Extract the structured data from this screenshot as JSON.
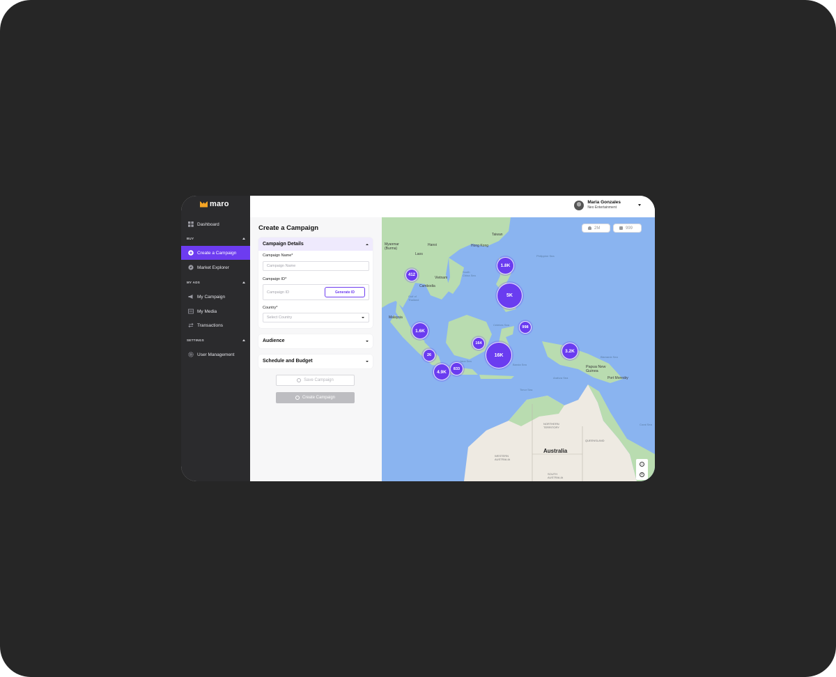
{
  "brand": {
    "name": "maro",
    "accent": "#6d3cf0",
    "logo_color": "#f5a524"
  },
  "sidebar": {
    "dashboard": {
      "label": "Dashboard",
      "icon": "grid-icon"
    },
    "sections": [
      {
        "title": "BUY",
        "items": [
          {
            "label": "Create a Campaign",
            "icon": "plus-circle-icon",
            "active": true
          },
          {
            "label": "Market Explorer",
            "icon": "compass-icon"
          }
        ]
      },
      {
        "title": "MY ADS",
        "items": [
          {
            "label": "My Campaign",
            "icon": "megaphone-icon"
          },
          {
            "label": "My Media",
            "icon": "media-icon"
          },
          {
            "label": "Transactions",
            "icon": "swap-icon"
          }
        ]
      },
      {
        "title": "SETTINGS",
        "items": [
          {
            "label": "User Management",
            "icon": "gear-icon"
          }
        ]
      }
    ]
  },
  "user": {
    "name": "Maria Gonzales",
    "org": "Neo Entertainment"
  },
  "form": {
    "title": "Create a Campaign",
    "details": {
      "heading": "Campaign Details",
      "name_label": "Campaign Name*",
      "name_placeholder": "Campaign Name",
      "id_label": "Campaign ID*",
      "id_placeholder": "Campaign ID",
      "generate_label": "Generate ID",
      "country_label": "Country*",
      "country_placeholder": "Select Country"
    },
    "audience": "Audience",
    "schedule": "Schedule and Budget",
    "save_label": "Save Campaign",
    "create_label": "Create Campaign"
  },
  "map": {
    "stats": {
      "audience": "2M",
      "screens": "999"
    },
    "labels": {
      "myanmar": "Myanmar\n(Burma)",
      "laos": "Laos",
      "hanoi": "Hanoi",
      "hongkong": "Hong Kong",
      "taiwan": "Taiwan",
      "vietnam": "Vietnam",
      "cambodia": "Cambodia",
      "malaysia": "Malaysia",
      "philippine_sea": "Philippine Sea",
      "south_china_sea": "South\nChina Sea",
      "gulf_thailand": "Gulf of\nThailand",
      "celebes": "Celebes Sea",
      "banda": "Banda Sea",
      "java": "Java Sea",
      "arafura": "Arafura Sea",
      "timor": "Timor Sea",
      "bismarck": "Bismarck Sea",
      "png": "Papua New\nGuinea",
      "port_moresby": "Port Moresby",
      "coral": "Coral Sea",
      "australia": "Australia",
      "nt": "NORTHERN\nTERRITORY",
      "qld": "QUEENSLAND",
      "wa": "WESTERN\nAUSTRALIA",
      "sa": "SOUTH\nAUSTRALIA"
    },
    "clusters": [
      {
        "label": "412"
      },
      {
        "label": "1.8K"
      },
      {
        "label": "5K"
      },
      {
        "label": "998"
      },
      {
        "label": "1.6K"
      },
      {
        "label": "164"
      },
      {
        "label": "16K"
      },
      {
        "label": "3.2K"
      },
      {
        "label": "26"
      },
      {
        "label": "833"
      },
      {
        "label": "4.9K"
      }
    ]
  }
}
